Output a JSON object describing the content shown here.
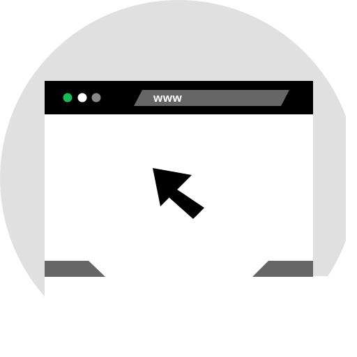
{
  "browser": {
    "address_bar": {
      "text": "www"
    },
    "window_controls": [
      "green-dot",
      "white-dot",
      "gray-dot"
    ]
  },
  "icons": {
    "cursor": "mouse-pointer-icon"
  },
  "colors": {
    "background_circle": "#e0e0e0",
    "titlebar": "#000000",
    "address_bar": "#666666",
    "dot_green": "#1db954",
    "dot_white": "#ffffff",
    "dot_gray": "#888888",
    "window": "#ffffff",
    "cursor": "#000000",
    "tab_shapes": "#666666"
  }
}
